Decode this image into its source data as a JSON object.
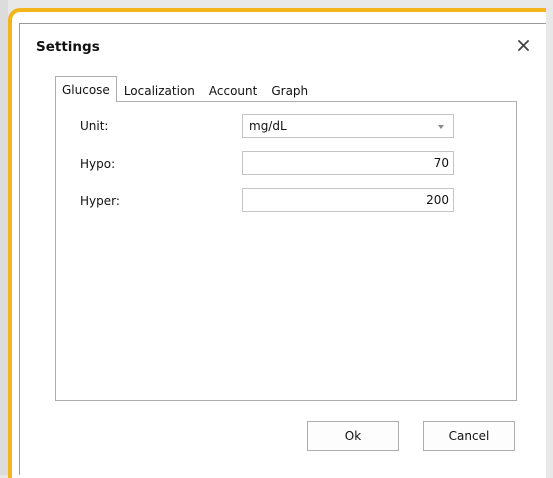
{
  "dialog": {
    "title": "Settings",
    "close_icon": "close-icon"
  },
  "tabs": [
    {
      "label": "Glucose",
      "active": true
    },
    {
      "label": "Localization",
      "active": false
    },
    {
      "label": "Account",
      "active": false
    },
    {
      "label": "Graph",
      "active": false
    }
  ],
  "glucose": {
    "unit_label": "Unit:",
    "unit_value": "mg/dL",
    "hypo_label": "Hypo:",
    "hypo_value": "70",
    "hyper_label": "Hyper:",
    "hyper_value": "200"
  },
  "buttons": {
    "ok": "Ok",
    "cancel": "Cancel"
  },
  "colors": {
    "frame_accent": "#f2b51c",
    "border": "#adadad"
  }
}
